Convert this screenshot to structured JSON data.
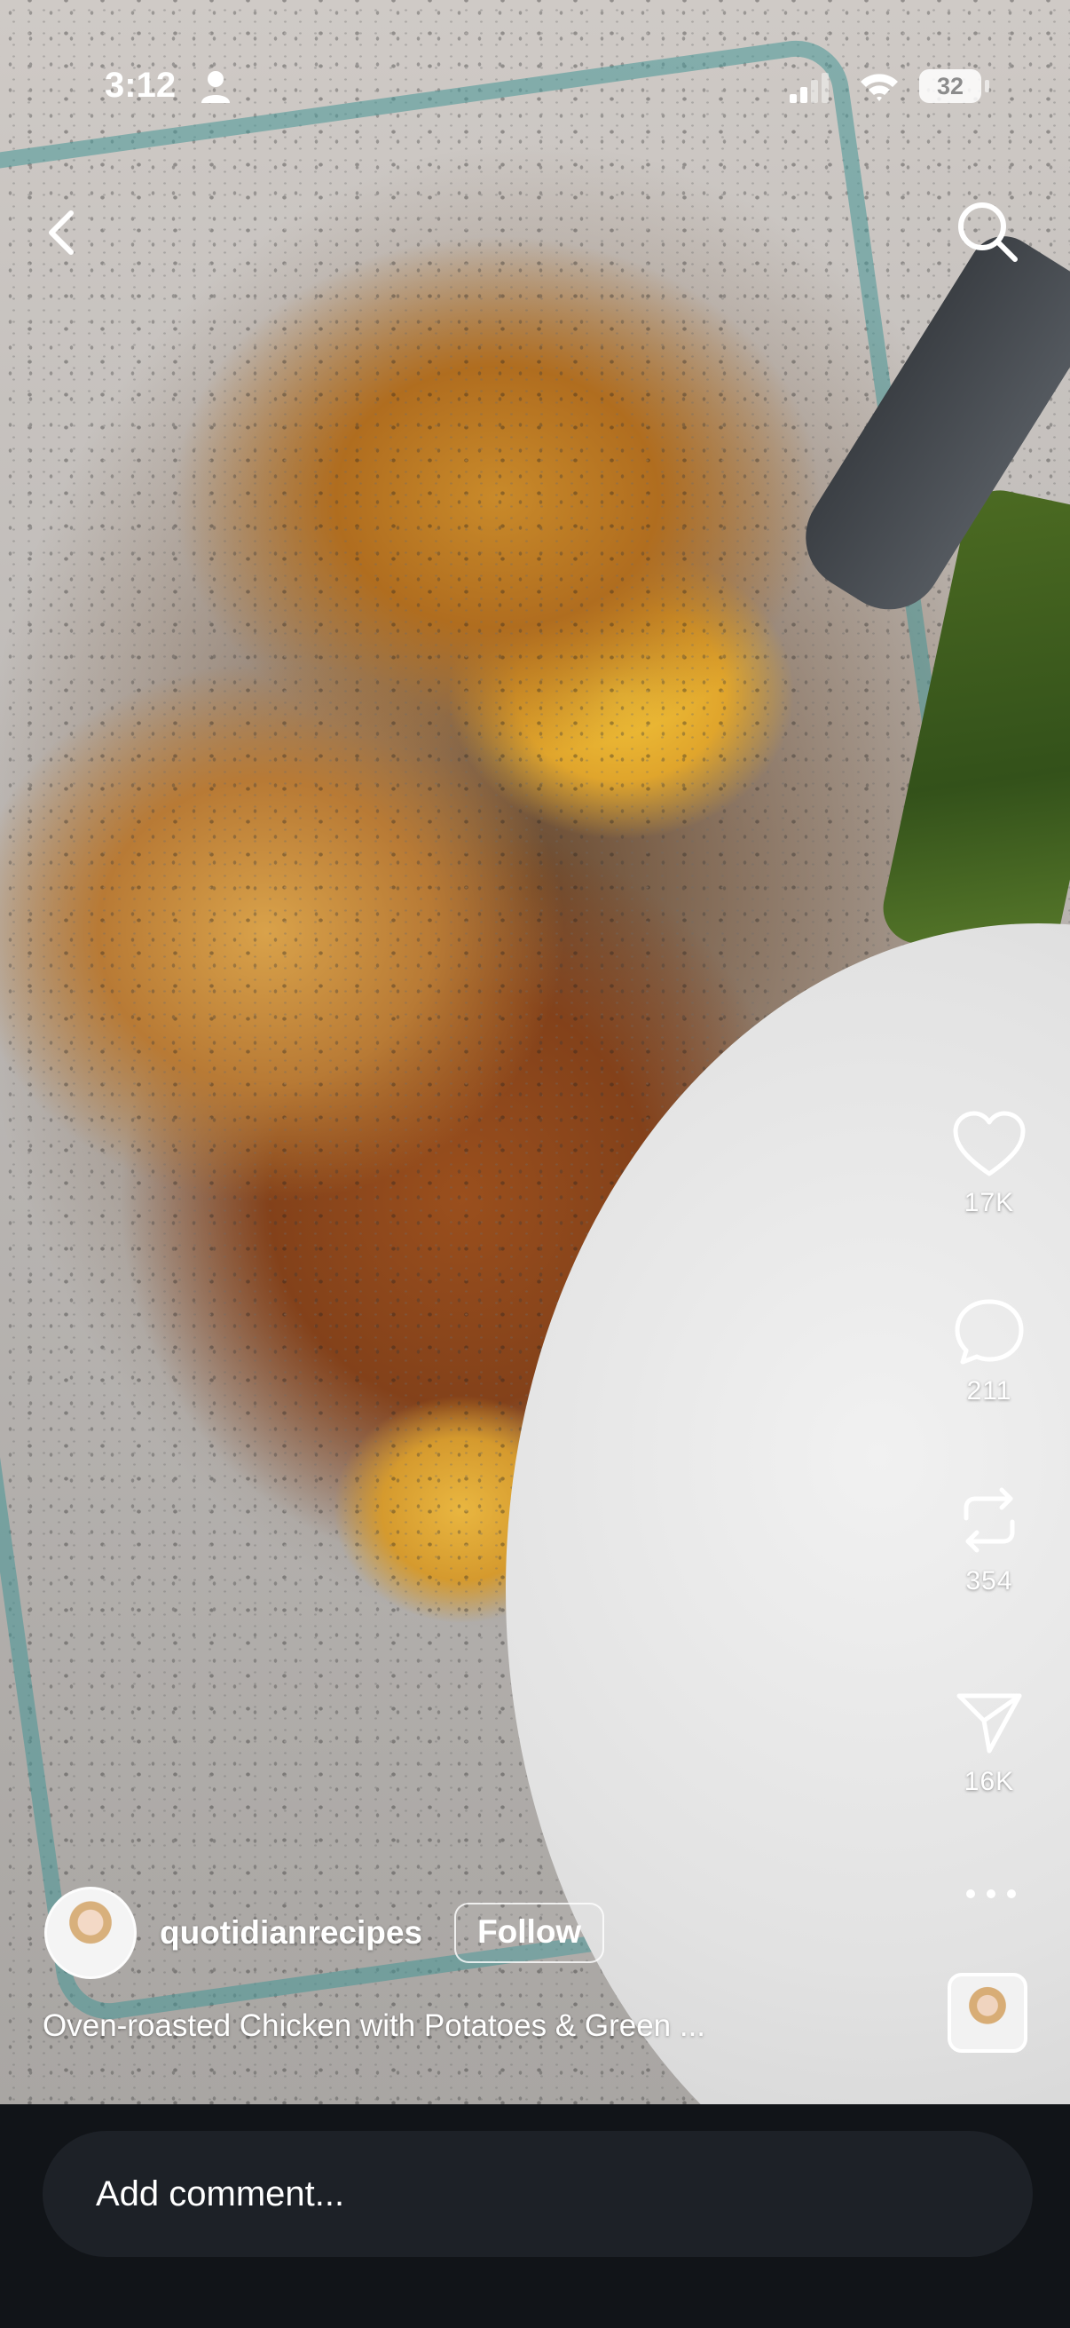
{
  "status_bar": {
    "time": "3:12",
    "battery": "32"
  },
  "navigation": {
    "back_icon": "chevron-left-icon",
    "search_icon": "search-icon"
  },
  "actions": {
    "likes": "17K",
    "comments": "211",
    "reposts": "354",
    "shares": "16K"
  },
  "post": {
    "username": "quotidianrecipes",
    "follow_label": "Follow",
    "caption": "Oven-roasted Chicken with Potatoes & Green ..."
  },
  "comment_box": {
    "placeholder": "Add comment..."
  }
}
